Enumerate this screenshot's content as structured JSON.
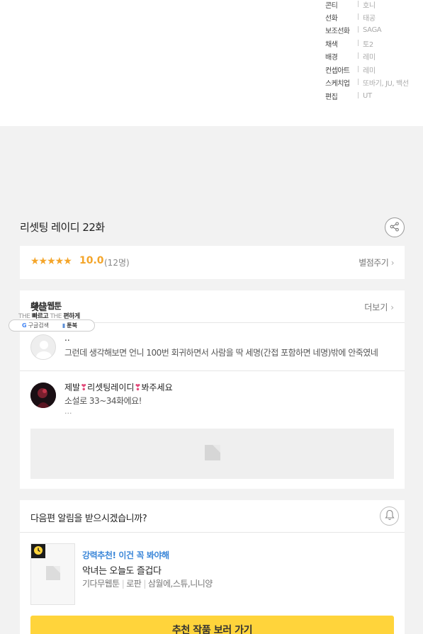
{
  "credits": [
    {
      "role": "콘티",
      "name": "호니"
    },
    {
      "role": "선화",
      "name": "태공"
    },
    {
      "role": "보조선화",
      "name": "SAGA"
    },
    {
      "role": "채색",
      "name": "토2"
    },
    {
      "role": "배경",
      "name": "레미"
    },
    {
      "role": "컨셉아트",
      "name": "레미"
    },
    {
      "role": "스케치업",
      "name": "또바기, JU, 백선"
    },
    {
      "role": "편집",
      "name": "UT"
    }
  ],
  "episode": {
    "title": "리셋팅 레이디 22화"
  },
  "rating": {
    "stars": "★★★★★",
    "score": "10.0",
    "count": "(12명)",
    "rate_button": "별점주기"
  },
  "comments": {
    "label": "댓글",
    "more_button": "더보기",
    "items": [
      {
        "name": "..",
        "body": "그런데 생각해보면 언니 100번 회귀하면서 사람을 딱 세명(간접 포함하면 네명)밖에 안죽였네",
        "more": ""
      },
      {
        "name_prefix": "제발",
        "name_mid": "리셋팅레이디",
        "name_suffix": "봐주세요",
        "body": "소설로 33~34화에요!",
        "more": "..."
      }
    ]
  },
  "ad": {
    "title": "최신 웹툰",
    "tag_the1": "THE",
    "tag_fast": "빠르고",
    "tag_the2": "THE",
    "tag_easy": "편하게",
    "search_label": "구글검색",
    "book_label": "툰북"
  },
  "notify": {
    "label": "다음편 알림을 받으시겠습니까?"
  },
  "recommend": {
    "tag": "강력추천! 이건 꼭 봐야해",
    "title": "악녀는 오늘도 즐겁다",
    "meta": [
      "기다무웹툰",
      "로판",
      "삼월에,스튜,니니양"
    ],
    "button": "추천 작품 보러 가기"
  },
  "colors": {
    "star": "#f4a52a",
    "accent_blue": "#3a86d8",
    "button_yellow": "#ffd43b"
  }
}
